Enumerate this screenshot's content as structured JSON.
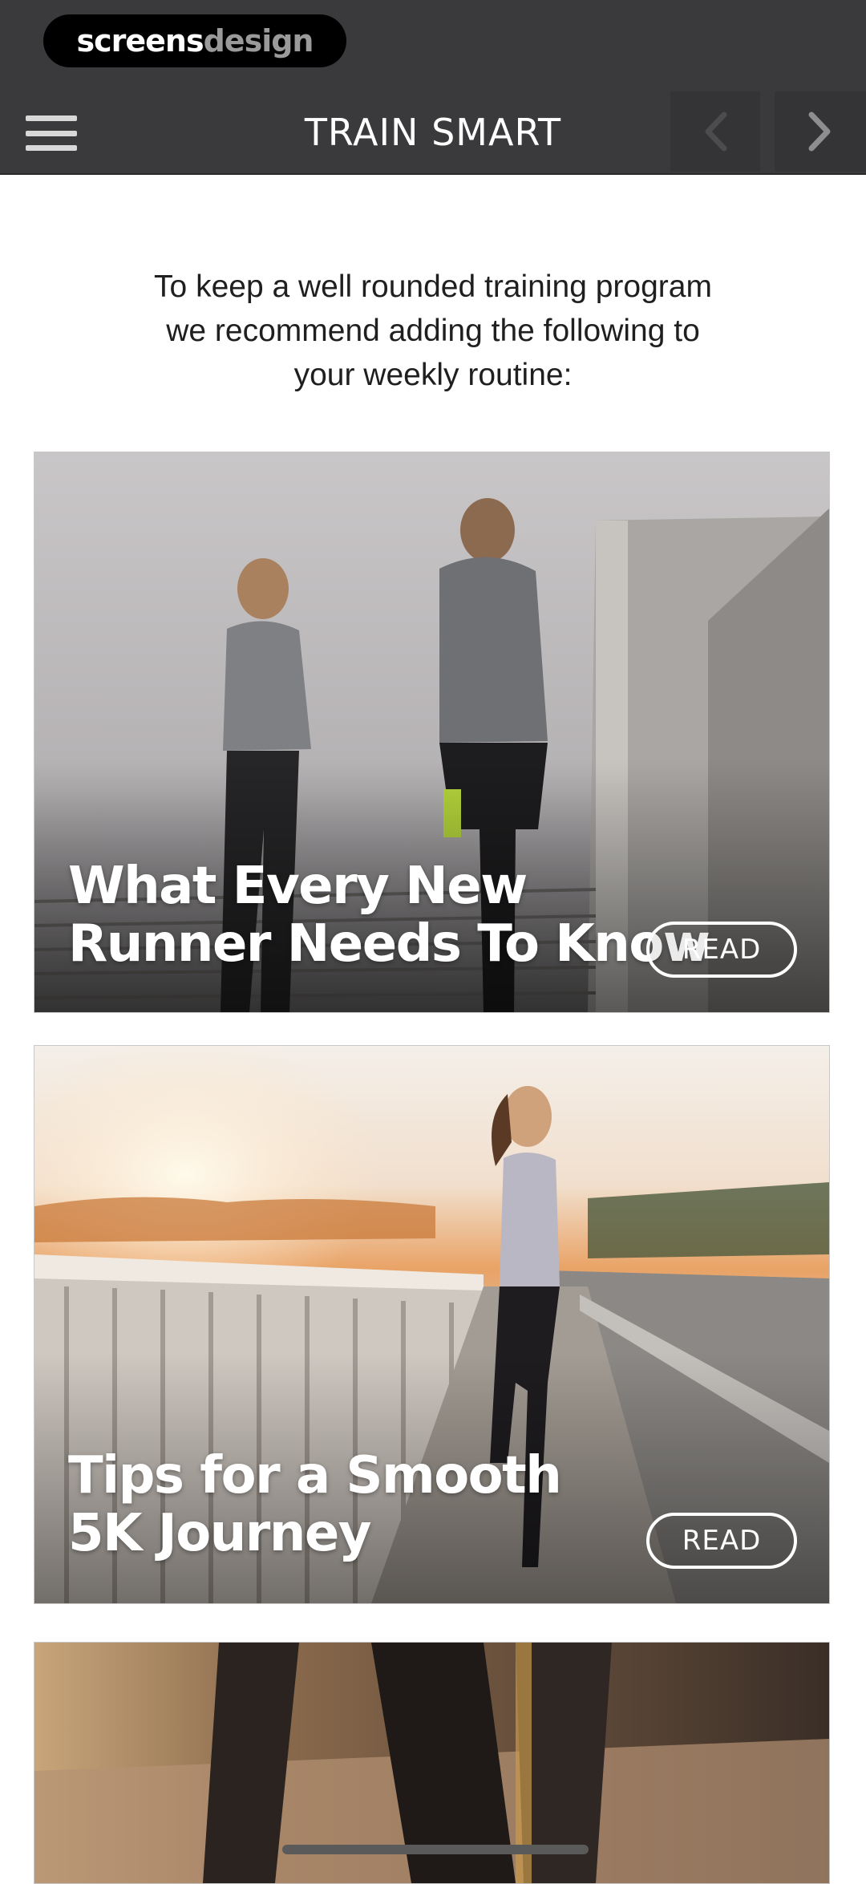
{
  "brand": {
    "part1": "screens",
    "part2": "design"
  },
  "navbar": {
    "title": "TRAIN SMART",
    "prev_icon": "chevron-left-icon",
    "next_icon": "chevron-right-icon",
    "menu_icon": "hamburger-menu-icon"
  },
  "intro": {
    "line1": "To keep a well rounded training program",
    "line2": "we recommend adding the following to",
    "line3": "your weekly routine:"
  },
  "articles": [
    {
      "title_line1": "What Every New",
      "title_line2": "Runner Needs To Know",
      "button": "READ"
    },
    {
      "title_line1": "Tips for a Smooth",
      "title_line2": "5K Journey",
      "button": "READ"
    }
  ],
  "colors": {
    "header_bg": "#3a393b",
    "nav_arrow_bg": "#343335",
    "text_dark": "#1f1f1f",
    "white": "#ffffff"
  }
}
